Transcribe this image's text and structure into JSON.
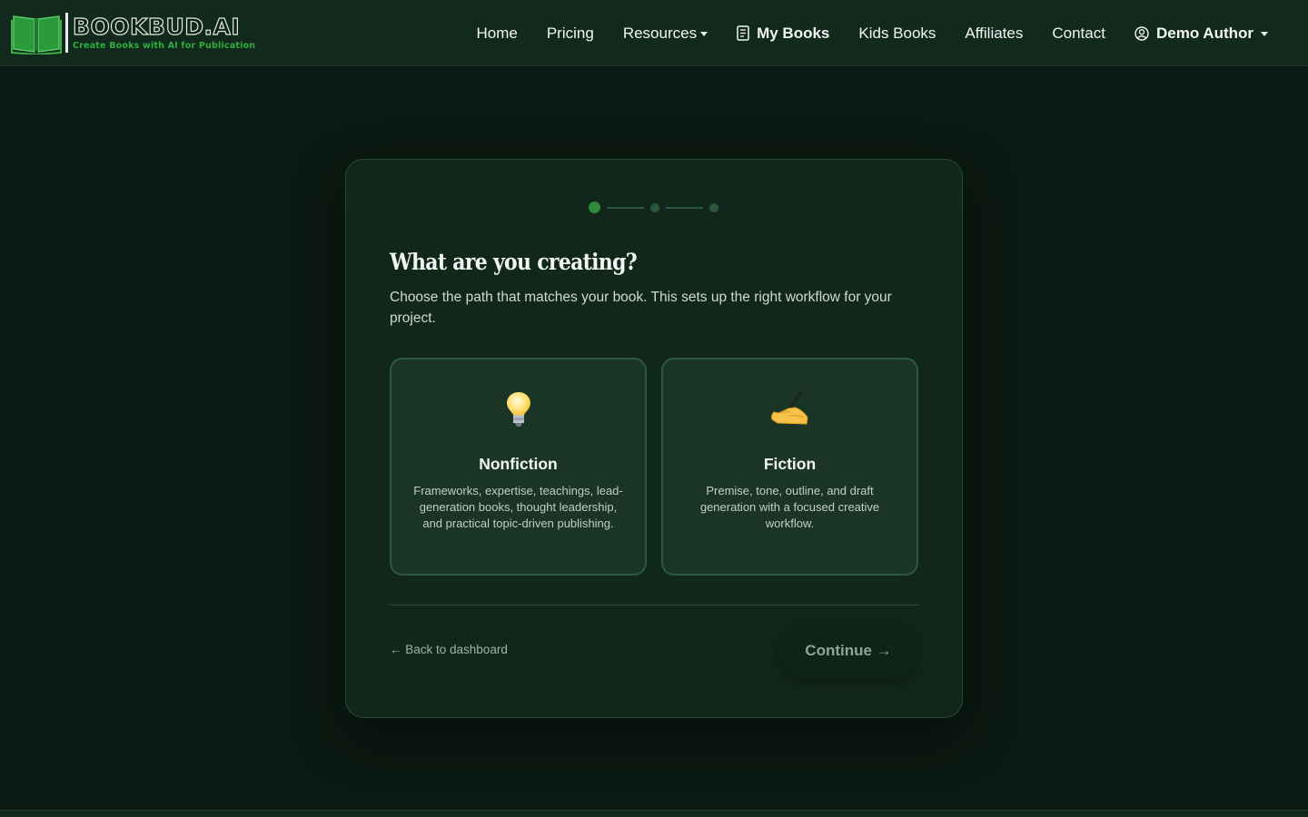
{
  "brand": {
    "name": "BOOKBUD.AI",
    "tagline": "Create Books with AI for Publication",
    "accent": "#2fae3e"
  },
  "nav": {
    "items": [
      {
        "label": "Home"
      },
      {
        "label": "Pricing"
      },
      {
        "label": "Resources"
      },
      {
        "label": "My Books"
      },
      {
        "label": "Kids Books"
      },
      {
        "label": "Affiliates"
      },
      {
        "label": "Contact"
      },
      {
        "label": "Demo Author"
      }
    ]
  },
  "wizard": {
    "steps_total": 3,
    "current_step": 1,
    "title": "What are you creating?",
    "subtitle": "Choose the path that matches your book. This sets up the right workflow for your project.",
    "options": [
      {
        "icon": "lightbulb-icon",
        "title": "Nonfiction",
        "description": "Frameworks, expertise, teachings, lead-generation books, thought leadership, and practical topic-driven publishing."
      },
      {
        "icon": "writing-hand-icon",
        "title": "Fiction",
        "description": "Premise, tone, outline, and draft generation with a focused creative workflow."
      }
    ],
    "back_label": "← Back to dashboard",
    "continue_label": "Continue →"
  },
  "colors": {
    "background": "#0b1a12",
    "navbar": "#12291e",
    "card": "#11271c",
    "option_card": "#1a3425",
    "step_active": "#2f8a3a"
  }
}
